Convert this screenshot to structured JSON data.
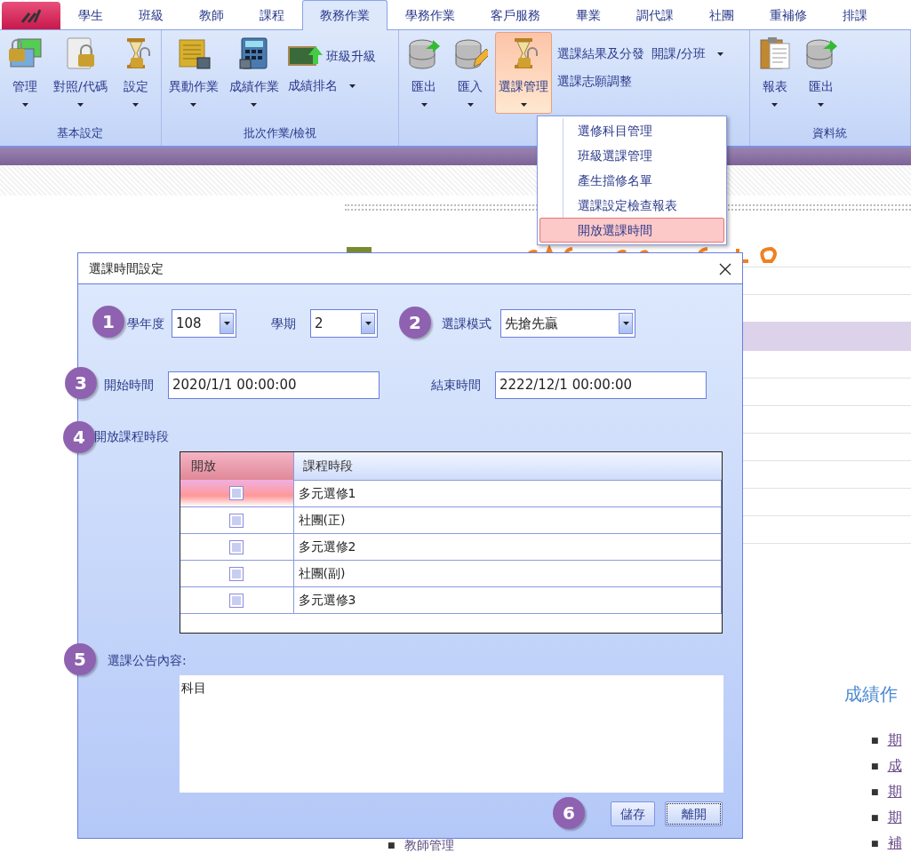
{
  "ribbon": {
    "tabs": [
      {
        "label": "學生",
        "selected": false
      },
      {
        "label": "班級",
        "selected": false
      },
      {
        "label": "教師",
        "selected": false
      },
      {
        "label": "課程",
        "selected": false
      },
      {
        "label": "教務作業",
        "selected": true
      },
      {
        "label": "學務作業",
        "selected": false
      },
      {
        "label": "客戶服務",
        "selected": false
      },
      {
        "label": "畢業",
        "selected": false
      },
      {
        "label": "調代課",
        "selected": false
      },
      {
        "label": "社團",
        "selected": false
      },
      {
        "label": "重補修",
        "selected": false
      },
      {
        "label": "排課",
        "selected": false
      }
    ],
    "groups": [
      {
        "label": "基本設定",
        "items": [
          {
            "label": "管理",
            "kind": "large",
            "dropdown": true,
            "pressed": false
          },
          {
            "label": "對照/代碼",
            "kind": "large",
            "dropdown": true,
            "pressed": false
          },
          {
            "label": "設定",
            "kind": "large",
            "dropdown": true,
            "pressed": false
          }
        ]
      },
      {
        "label": "批次作業/檢視",
        "items": [
          {
            "label": "異動作業",
            "kind": "large",
            "dropdown": true,
            "pressed": false
          },
          {
            "label": "成績作業",
            "kind": "large",
            "dropdown": true,
            "pressed": false
          },
          {
            "label": "班級升級",
            "kind": "small",
            "dropdown": false,
            "pressed": false
          },
          {
            "label": "成績排名",
            "kind": "small",
            "dropdown": true,
            "pressed": false
          }
        ]
      },
      {
        "items": [
          {
            "label": "匯出",
            "kind": "large",
            "dropdown": true,
            "pressed": false
          },
          {
            "label": "匯入",
            "kind": "large",
            "dropdown": true,
            "pressed": false
          },
          {
            "label": "選課管理",
            "kind": "large",
            "dropdown": true,
            "pressed": true
          },
          {
            "label": "選課結果及分發",
            "kind": "small",
            "dropdown": false,
            "pressed": false
          },
          {
            "label": "選課志願調整",
            "kind": "small",
            "dropdown": false,
            "pressed": false
          },
          {
            "label": "開課/分班",
            "kind": "small",
            "dropdown": true,
            "pressed": false
          }
        ]
      },
      {
        "label": "資料統",
        "items": [
          {
            "label": "報表",
            "kind": "large",
            "dropdown": true,
            "pressed": false
          },
          {
            "label": "匯出",
            "kind": "large",
            "dropdown": true,
            "pressed": false
          }
        ]
      }
    ]
  },
  "menu": {
    "items": [
      {
        "label": "選修科目管理",
        "selected": false
      },
      {
        "label": "班級選課管理",
        "selected": false
      },
      {
        "label": "產生擋修名單",
        "selected": false
      },
      {
        "label": "選課設定檢查報表",
        "selected": false
      },
      {
        "label": "開放選課時間",
        "selected": true
      }
    ]
  },
  "background_page": {
    "heading": "成績作",
    "links": [
      {
        "marker": "■",
        "text": "期"
      },
      {
        "marker": "■",
        "text": "成"
      },
      {
        "marker": "■",
        "text": "期"
      },
      {
        "marker": "■",
        "text": "期"
      },
      {
        "marker": "■",
        "text": "補"
      }
    ],
    "list_item": {
      "marker": "■",
      "text": "教師管理"
    }
  },
  "dialog": {
    "title": "選課時間設定",
    "school_year": {
      "label": "學年度",
      "value": "108"
    },
    "semester": {
      "label": "學期",
      "value": "2"
    },
    "mode": {
      "label": "選課模式",
      "value": "先搶先贏"
    },
    "start_time": {
      "label": "開始時間",
      "value": "2020/1/1 00:00:00"
    },
    "end_time": {
      "label": "結束時間",
      "value": "2222/12/1 00:00:00"
    },
    "periods": {
      "label": "開放課程時段",
      "columns": [
        "開放",
        "課程時段"
      ],
      "rows": [
        {
          "open": false,
          "period": "多元選修1",
          "selected": true
        },
        {
          "open": false,
          "period": "社團(正)",
          "selected": false
        },
        {
          "open": false,
          "period": "多元選修2",
          "selected": false
        },
        {
          "open": false,
          "period": "社團(副)",
          "selected": false
        },
        {
          "open": false,
          "period": "多元選修3",
          "selected": false
        }
      ]
    },
    "notice": {
      "label": "選課公告內容:",
      "value": "科目"
    },
    "buttons": [
      {
        "label": "儲存",
        "focused": false
      },
      {
        "label": "離開",
        "focused": true
      }
    ],
    "markers": [
      "1",
      "2",
      "3",
      "4",
      "5",
      "6"
    ]
  }
}
